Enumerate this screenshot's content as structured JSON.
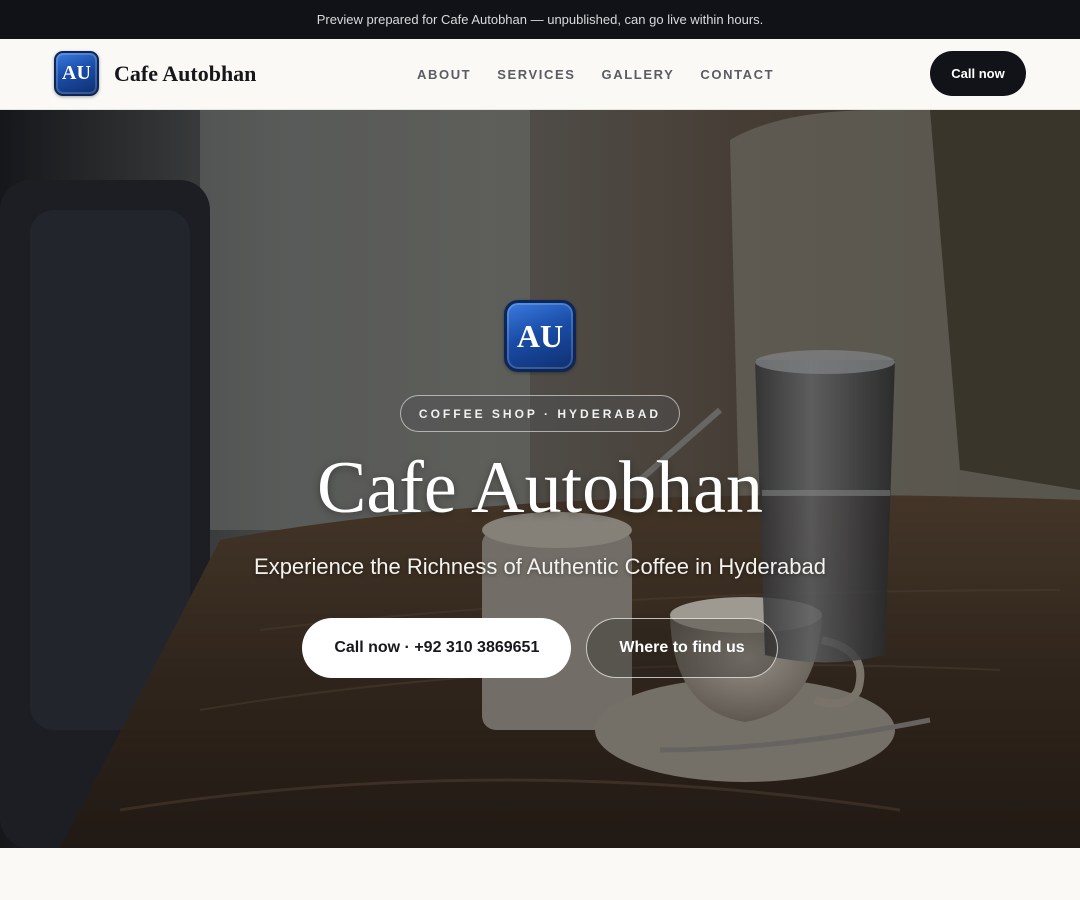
{
  "banner": {
    "text": "Preview prepared for Cafe Autobhan — unpublished, can go live within hours."
  },
  "header": {
    "logo_text": "AU",
    "brand_name": "Cafe Autobhan",
    "nav": [
      {
        "label": "ABOUT"
      },
      {
        "label": "SERVICES"
      },
      {
        "label": "GALLERY"
      },
      {
        "label": "CONTACT"
      }
    ],
    "cta_label": "Call now"
  },
  "hero": {
    "logo_text": "AU",
    "tag": "COFFEE SHOP · HYDERABAD",
    "title": "Cafe Autobhan",
    "subtitle": "Experience the Richness of Authentic Coffee in Hyderabad",
    "primary_button": "Call now · +92 310 3869651",
    "secondary_button": "Where to find us"
  },
  "colors": {
    "dark": "#111217",
    "page_background": "#faf9f6",
    "logo_blue": "#1a4da8"
  }
}
